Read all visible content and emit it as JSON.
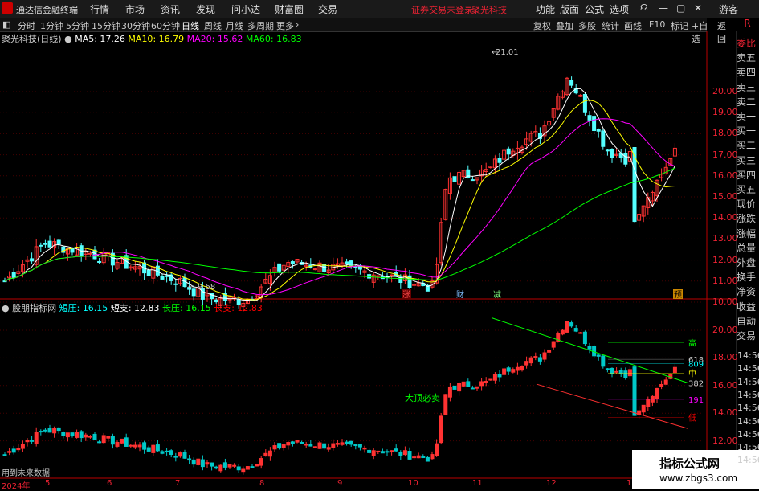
{
  "app": {
    "title": "通达信金融终端",
    "menu": [
      "行情",
      "市场",
      "资讯",
      "发现",
      "问小达",
      "财富圈",
      "交易"
    ],
    "login_status": "证券交易未登录",
    "stock_name": "聚光科技",
    "right_menu": [
      "功能",
      "版面",
      "公式",
      "选项"
    ],
    "guest": "游客"
  },
  "toolbar": {
    "periods": [
      "分时",
      "1分钟",
      "5分钟",
      "15分钟",
      "30分钟",
      "60分钟",
      "日线",
      "周线",
      "月线",
      "多周期",
      "更多"
    ],
    "active_period": "日线",
    "tools": [
      "复权",
      "叠加",
      "多股",
      "统计",
      "画线",
      "F10",
      "标记",
      "+自选",
      "返回"
    ]
  },
  "main_chart": {
    "stock_label": "聚光科技(日线)",
    "ma": [
      {
        "name": "MA5",
        "value": "17.26",
        "color": "#ffffff"
      },
      {
        "name": "MA10",
        "value": "16.79",
        "color": "#ffff00"
      },
      {
        "name": "MA20",
        "value": "15.62",
        "color": "#ff00ff"
      },
      {
        "name": "MA60",
        "value": "16.83",
        "color": "#00ff00"
      }
    ],
    "y_ticks": [
      "20.00",
      "19.00",
      "18.00",
      "17.00",
      "16.00",
      "15.00",
      "14.00",
      "13.00",
      "12.00",
      "11.00",
      "10.00"
    ],
    "high_label": "21.01",
    "low_label": "9.68",
    "markers": [
      "涨",
      "财",
      "减",
      "预"
    ]
  },
  "indicator_chart": {
    "name": "股朋指标网",
    "fields": [
      {
        "name": "短压",
        "value": "16.15",
        "color": "#00ffff"
      },
      {
        "name": "短支",
        "value": "12.83",
        "color": "#ffffff"
      },
      {
        "name": "长压",
        "value": "16.15",
        "color": "#00ff00"
      },
      {
        "name": "长支",
        "value": "12.83",
        "color": "#ff0000"
      }
    ],
    "y_ticks": [
      "20.00",
      "18.00",
      "16.00",
      "14.00",
      "12.00"
    ],
    "levels": [
      {
        "label": "高",
        "color": "#00ff00"
      },
      {
        "label": "809",
        "color": "#00ffff"
      },
      {
        "label": "618",
        "color": "#cccccc"
      },
      {
        "label": "中",
        "color": "#ffff00"
      },
      {
        "label": "382",
        "color": "#cccccc"
      },
      {
        "label": "191",
        "color": "#ff00ff"
      },
      {
        "label": "低",
        "color": "#ff0000"
      }
    ],
    "signal_text": "大顶必卖",
    "future_note": "用到未来数据"
  },
  "x_axis": [
    "2024年",
    "5",
    "6",
    "7",
    "8",
    "9",
    "10",
    "11",
    "12",
    "1"
  ],
  "right_panel": {
    "r_badge": "R",
    "items": [
      "委比",
      "卖五",
      "卖四",
      "卖三",
      "卖二",
      "卖一",
      "买一",
      "买二",
      "买三",
      "买四",
      "买五",
      "现价",
      "涨跌",
      "涨幅",
      "总量",
      "外盘",
      "换手",
      "净资",
      "收益",
      "自动",
      "交易"
    ],
    "times": [
      "14:56",
      "14:56",
      "14:56",
      "14:56",
      "14:56",
      "14:56",
      "14:56",
      "14:56",
      "14:56"
    ]
  },
  "watermark": {
    "title": "指标公式网",
    "url": "www.zbgs3.com"
  }
}
